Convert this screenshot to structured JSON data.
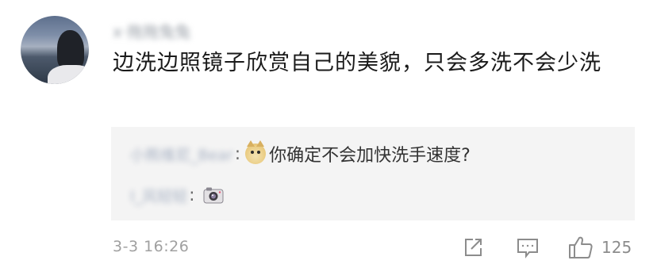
{
  "comment": {
    "username": "x·拖拖兔兔",
    "text": "边洗边照镜子欣赏自己的美貌，只会多洗不会少洗",
    "timestamp": "3-3 16:26",
    "like_count": "125"
  },
  "replies": [
    {
      "author": "小熊维尼_Bear",
      "colon": ":",
      "emoji_icon": "doge-emoji",
      "text": "你确定不会加快洗手速度?"
    },
    {
      "author": "I_风轻轻",
      "colon": ":",
      "emoji_icon": "camera-emoji"
    }
  ],
  "actions": [
    {
      "icon": "share-icon"
    },
    {
      "icon": "comment-icon"
    },
    {
      "icon": "thumbs-up-icon"
    }
  ],
  "colors": {
    "reply_background": "#f4f4f4",
    "meta_text": "#a0a0a0",
    "comment_text": "#1a1a1a"
  }
}
